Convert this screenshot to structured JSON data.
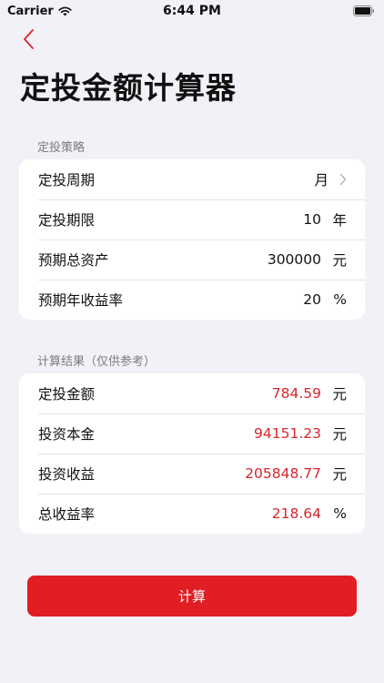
{
  "status_bar": {
    "carrier": "Carrier",
    "time": "6:44 PM"
  },
  "page": {
    "title": "定投金额计算器"
  },
  "strategy": {
    "section_label": "定投策略",
    "rows": [
      {
        "label": "定投周期",
        "value": "月",
        "unit": ""
      },
      {
        "label": "定投期限",
        "value": "10",
        "unit": "年"
      },
      {
        "label": "预期总资产",
        "value": "300000",
        "unit": "元"
      },
      {
        "label": "预期年收益率",
        "value": "20",
        "unit": "%"
      }
    ]
  },
  "results": {
    "section_label": "计算结果（仅供参考）",
    "rows": [
      {
        "label": "定投金额",
        "value": "784.59",
        "unit": "元"
      },
      {
        "label": "投资本金",
        "value": "94151.23",
        "unit": "元"
      },
      {
        "label": "投资收益",
        "value": "205848.77",
        "unit": "元"
      },
      {
        "label": "总收益率",
        "value": "218.64",
        "unit": "%"
      }
    ]
  },
  "calculate_button": {
    "label": "计算"
  },
  "colors": {
    "accent": "#e01e24",
    "result_value": "#d7262c",
    "background": "#f2f1f7"
  }
}
